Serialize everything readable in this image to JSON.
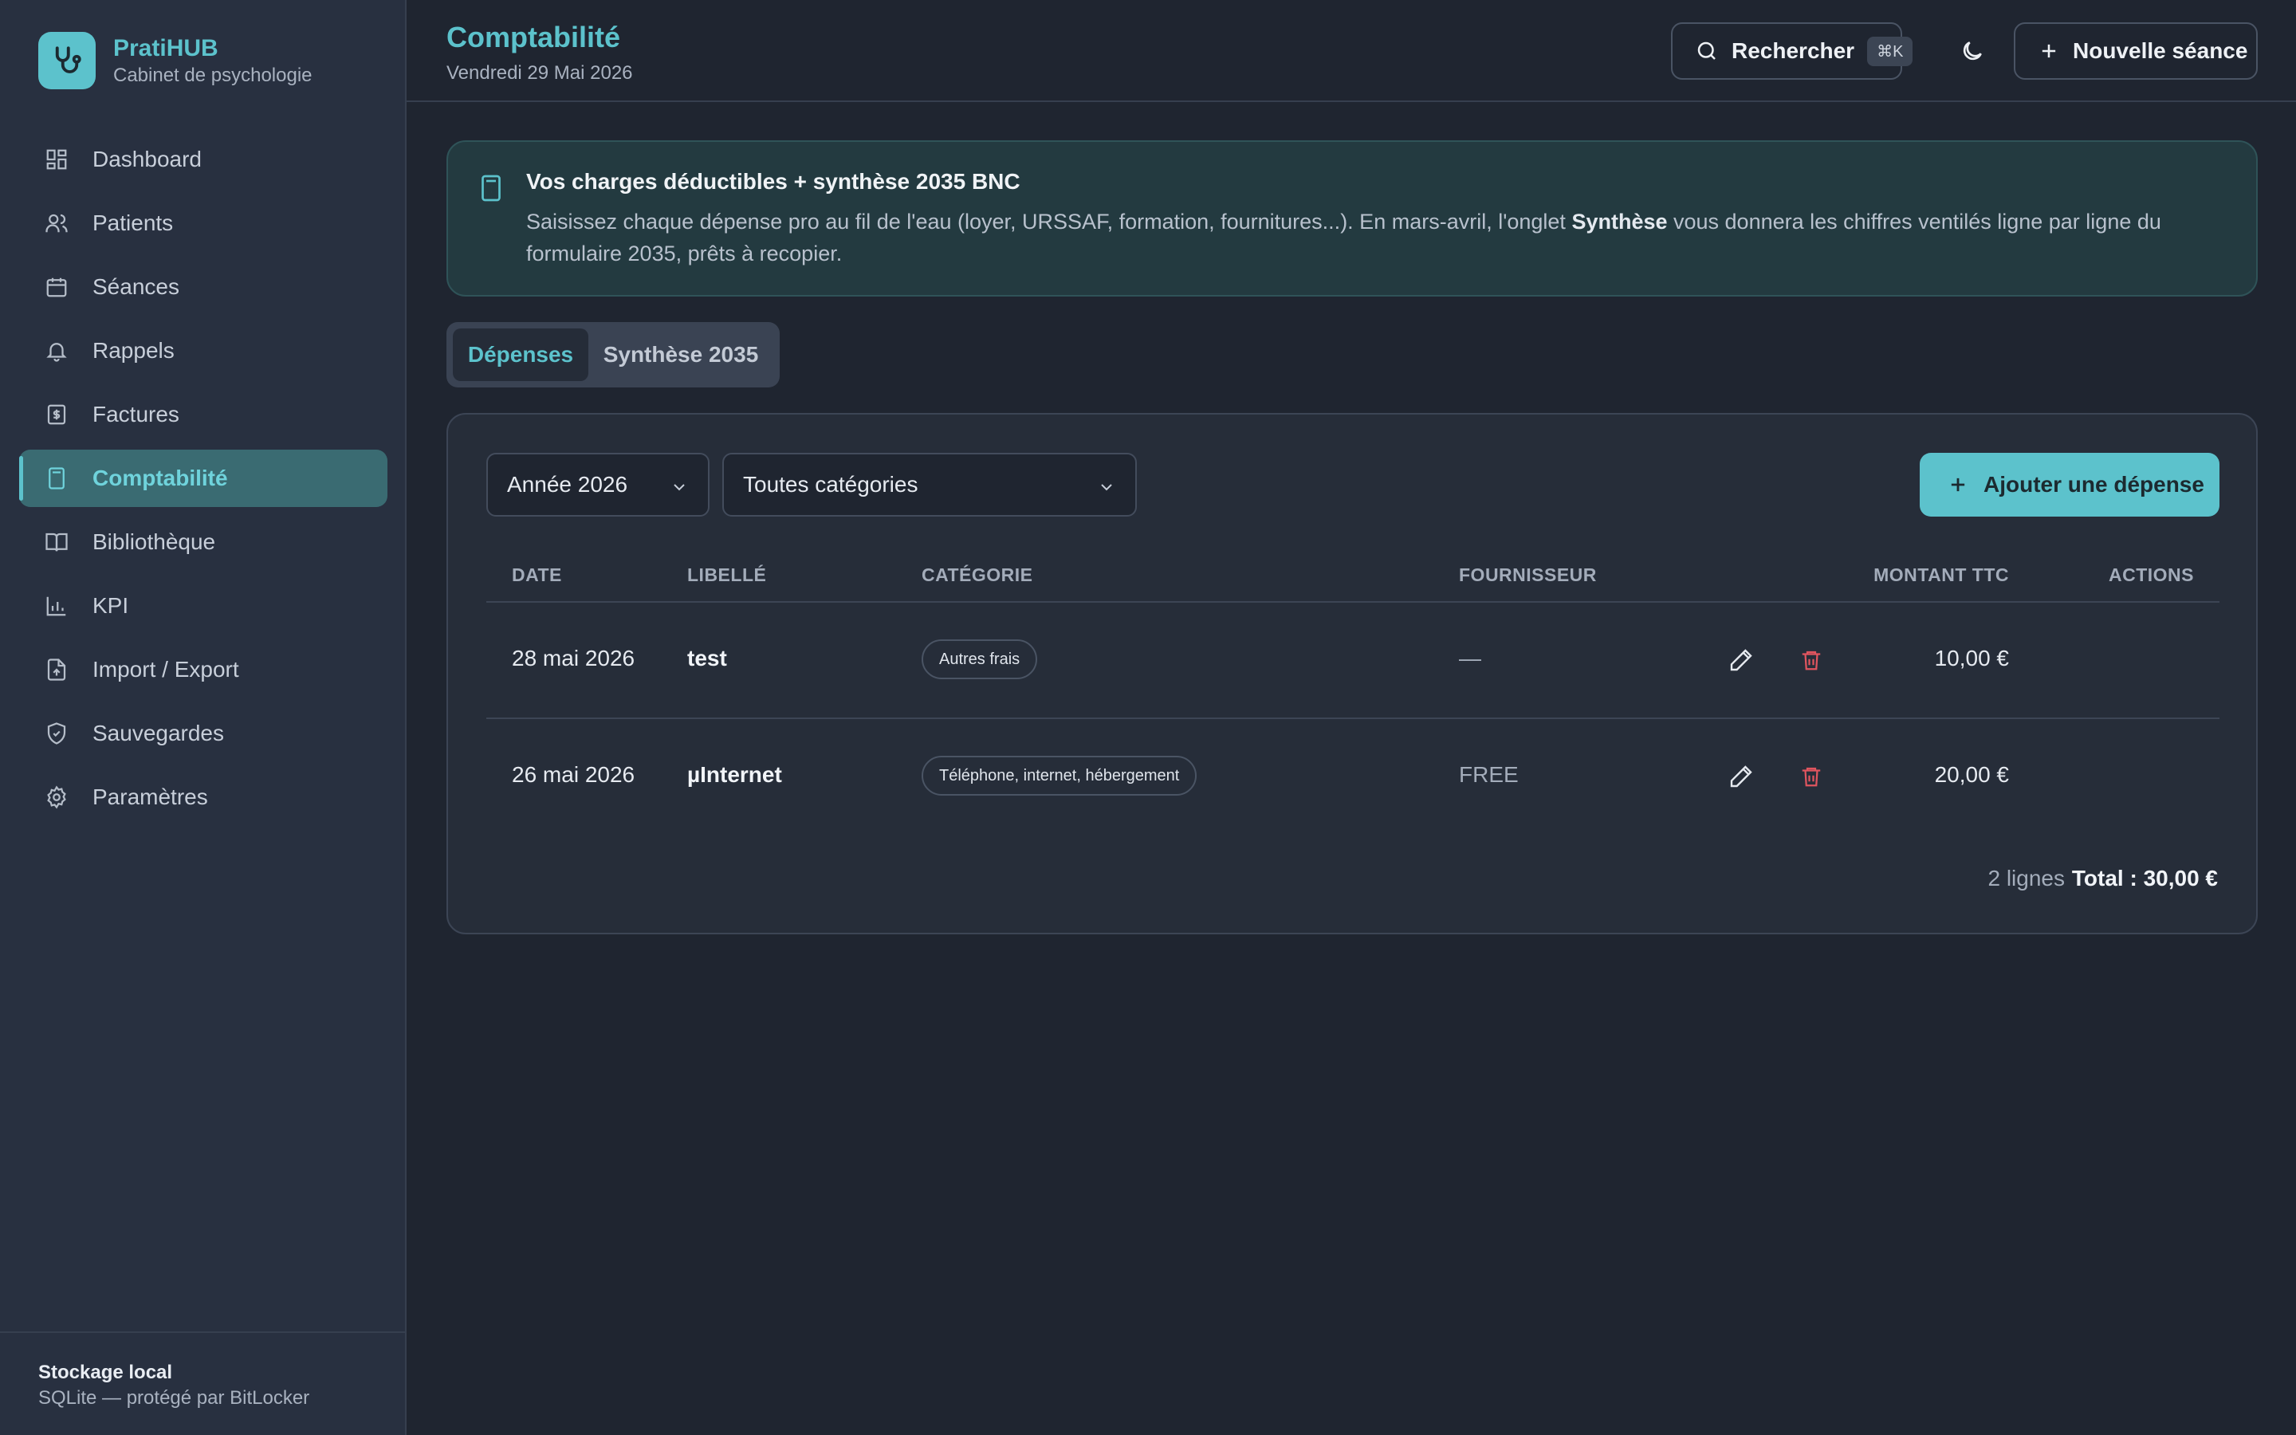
{
  "brand": {
    "name": "PratiHUB",
    "subtitle": "Cabinet de psychologie"
  },
  "sidebar": {
    "items": [
      {
        "label": "Dashboard",
        "icon": "dashboard-icon"
      },
      {
        "label": "Patients",
        "icon": "users-icon"
      },
      {
        "label": "Séances",
        "icon": "calendar-icon"
      },
      {
        "label": "Rappels",
        "icon": "bell-icon"
      },
      {
        "label": "Factures",
        "icon": "invoice-icon"
      },
      {
        "label": "Comptabilité",
        "icon": "calculator-icon",
        "active": true
      },
      {
        "label": "Bibliothèque",
        "icon": "book-icon"
      },
      {
        "label": "KPI",
        "icon": "bar-chart-icon"
      },
      {
        "label": "Import / Export",
        "icon": "file-export-icon"
      },
      {
        "label": "Sauvegardes",
        "icon": "shield-icon"
      },
      {
        "label": "Paramètres",
        "icon": "gear-icon"
      }
    ],
    "footer": {
      "title": "Stockage local",
      "subtitle": "SQLite — protégé par BitLocker"
    }
  },
  "header": {
    "title": "Comptabilité",
    "date": "Vendredi 29 Mai 2026",
    "search_label": "Rechercher",
    "search_shortcut": "⌘K",
    "new_session_label": "Nouvelle séance"
  },
  "banner": {
    "title": "Vos charges déductibles + synthèse 2035 BNC",
    "text_before": "Saisissez chaque dépense pro au fil de l'eau (loyer, URSSAF, formation, fournitures...). En mars-avril, l'onglet ",
    "text_bold": "Synthèse",
    "text_after": " vous donnera les chiffres ventilés ligne par ligne du formulaire 2035, prêts à recopier."
  },
  "tabs": [
    {
      "label": "Dépenses",
      "active": true
    },
    {
      "label": "Synthèse 2035",
      "active": false
    }
  ],
  "filters": {
    "year": "Année 2026",
    "category": "Toutes catégories",
    "add_label": "Ajouter une dépense"
  },
  "table": {
    "columns": [
      "DATE",
      "LIBELLÉ",
      "CATÉGORIE",
      "FOURNISSEUR",
      "MONTANT TTC",
      "ACTIONS"
    ],
    "rows": [
      {
        "date": "28 mai 2026",
        "label": "test",
        "category": "Autres frais",
        "supplier": "—",
        "amount": "10,00 €"
      },
      {
        "date": "26 mai 2026",
        "label": "µInternet",
        "category": "Téléphone, internet, hébergement",
        "supplier": "FREE",
        "amount": "20,00 €"
      }
    ],
    "count": "2 lignes",
    "total": "Total : 30,00 €"
  },
  "colors": {
    "accent": "#5cc2cc",
    "danger": "#e0555f",
    "background": "#1f2530",
    "sidebar": "#283040"
  }
}
